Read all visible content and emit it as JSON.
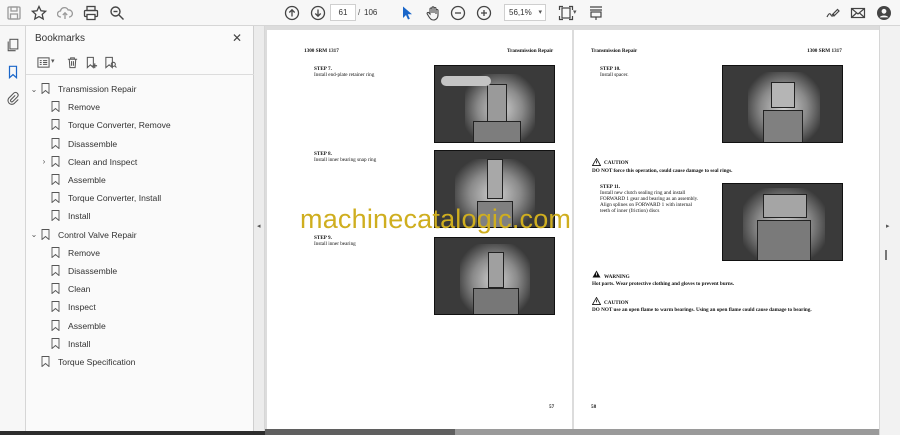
{
  "toolbar": {
    "icons": [
      "save-icon",
      "star-icon",
      "upload-icon",
      "print-icon",
      "zoom-search-icon",
      "page-up-icon",
      "page-down-icon",
      "select-cursor-icon",
      "hand-tool-icon",
      "zoom-out-icon",
      "zoom-in-icon",
      "fit-page-icon",
      "read-mode-icon",
      "sign-icon",
      "email-icon",
      "account-icon"
    ],
    "current_page": "61",
    "page_separator": "/",
    "total_pages": "106",
    "zoom": "56,1%",
    "zoom_caret": "▾",
    "fit_caret": "▾"
  },
  "rail": {
    "icons": [
      "copy-pages-icon",
      "bookmark-icon",
      "attachment-icon"
    ]
  },
  "bookmarks_panel": {
    "title": "Bookmarks",
    "close": "✕",
    "tools": [
      "options-icon",
      "delete-icon",
      "new-bookmark-icon",
      "bookmark-search-icon"
    ],
    "options_caret": "▾",
    "items": [
      {
        "label": "Transmission Repair",
        "level": 0,
        "expander": "⌄"
      },
      {
        "label": "Remove",
        "level": 1,
        "expander": ""
      },
      {
        "label": "Torque Converter, Remove",
        "level": 1,
        "expander": ""
      },
      {
        "label": "Disassemble",
        "level": 1,
        "expander": ""
      },
      {
        "label": "Clean and Inspect",
        "level": 1,
        "expander": "›"
      },
      {
        "label": "Assemble",
        "level": 1,
        "expander": ""
      },
      {
        "label": "Torque Converter, Install",
        "level": 1,
        "expander": ""
      },
      {
        "label": "Install",
        "level": 1,
        "expander": ""
      },
      {
        "label": "Control Valve Repair",
        "level": 0,
        "expander": "⌄"
      },
      {
        "label": "Remove",
        "level": 1,
        "expander": ""
      },
      {
        "label": "Disassemble",
        "level": 1,
        "expander": ""
      },
      {
        "label": "Clean",
        "level": 1,
        "expander": ""
      },
      {
        "label": "Inspect",
        "level": 1,
        "expander": ""
      },
      {
        "label": "Assemble",
        "level": 1,
        "expander": ""
      },
      {
        "label": "Install",
        "level": 1,
        "expander": ""
      },
      {
        "label": "Torque Specification",
        "level": 0,
        "expander": ""
      }
    ]
  },
  "splitter_arrow": "◂",
  "right_arrow": "▸",
  "left_page": {
    "header_left": "1300 SRM 1317",
    "header_right": "Transmission Repair",
    "step7_title": "STEP 7.",
    "step7_text": "Install end-plate retainer ring",
    "step8_title": "STEP 8.",
    "step8_text": "Install inner bearing snap ring",
    "step9_title": "STEP 9.",
    "step9_text": "Install inner bearing",
    "page_number": "57"
  },
  "right_page": {
    "header_left": "Transmission Repair",
    "header_right": "1300 SRM 1317",
    "step10_title": "STEP 10.",
    "step10_text": "Install spacer.",
    "caution1_title": "CAUTION",
    "caution1_text": "DO NOT force this operation, could cause damage to seal rings.",
    "step11_title": "STEP 11.",
    "step11_text1": "Install new clutch sealing ring and install",
    "step11_text2": "FORWARD 1 gear and bearing as an assembly.",
    "step11_text3": "Align splines on FORWARD 1 with internal",
    "step11_text4": "teeth of inner (friction) discs",
    "warning_title": "WARNING",
    "warning_text": "Hot parts. Wear protective clothing and gloves to prevent burns.",
    "caution2_title": "CAUTION",
    "caution2_text": "DO NOT use an open flame to warm bearings. Using an open flame could cause damage to bearing.",
    "page_number": "58"
  },
  "watermark": "machinecatalogic.com",
  "colors": {
    "watermark": "#cfae1f",
    "rail_active": "#1a66c9"
  }
}
